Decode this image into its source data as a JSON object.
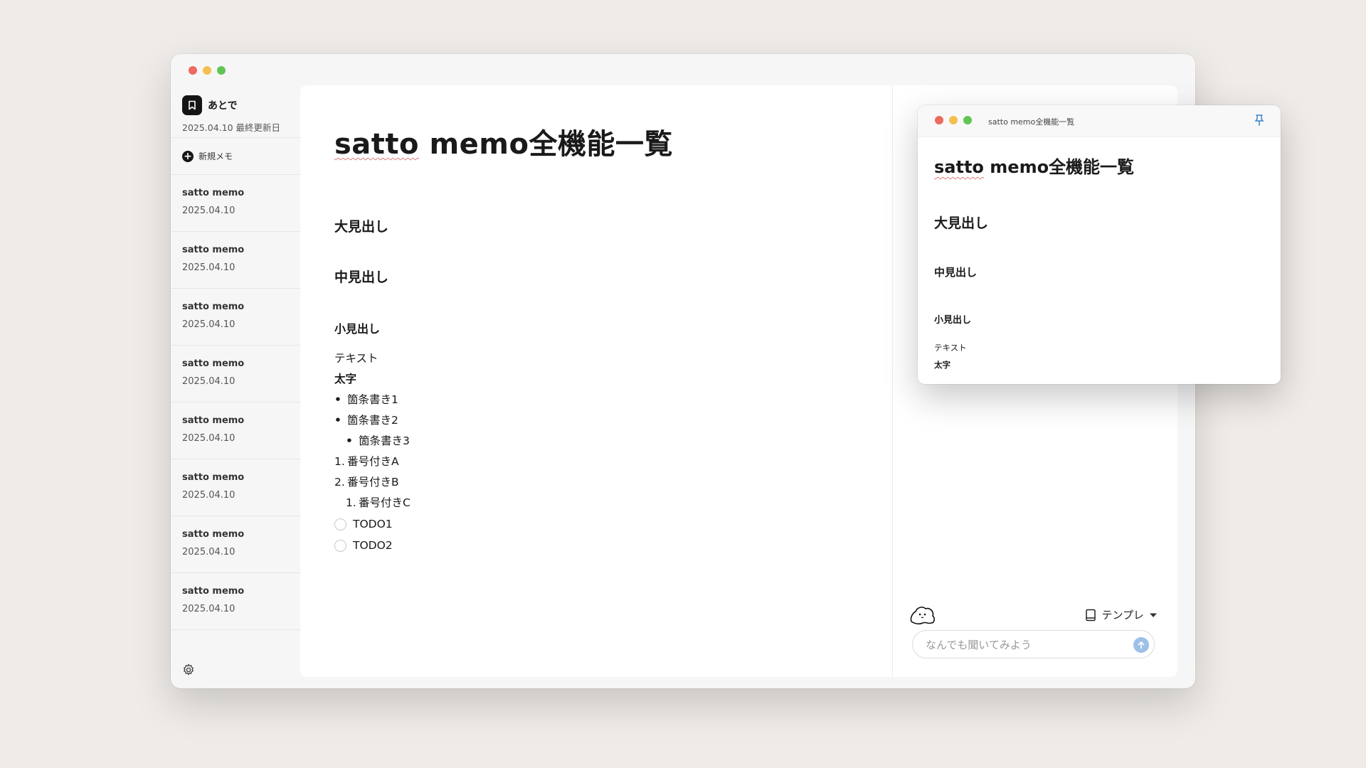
{
  "app": {
    "brand_name": "あとで",
    "last_updated": "2025.04.10 最終更新日",
    "new_memo_label": "新規メモ"
  },
  "memos": [
    {
      "title": "satto memo",
      "date": "2025.04.10"
    },
    {
      "title": "satto memo",
      "date": "2025.04.10"
    },
    {
      "title": "satto memo",
      "date": "2025.04.10"
    },
    {
      "title": "satto memo",
      "date": "2025.04.10"
    },
    {
      "title": "satto memo",
      "date": "2025.04.10"
    },
    {
      "title": "satto memo",
      "date": "2025.04.10"
    },
    {
      "title": "satto memo",
      "date": "2025.04.10"
    },
    {
      "title": "satto memo",
      "date": "2025.04.10"
    }
  ],
  "document": {
    "title_latin": "satto",
    "title_rest": " memo全機能一覧",
    "heading_large": "大見出し",
    "heading_medium": "中見出し",
    "heading_small": "小見出し",
    "text": "テキスト",
    "bold_text": "太字",
    "bullet_marker": "•",
    "bullets": [
      "箇条書き1",
      "箇条書き2",
      "箇条書き3"
    ],
    "numbered": [
      {
        "marker": "1.",
        "text": "番号付きA"
      },
      {
        "marker": "2.",
        "text": "番号付きB"
      },
      {
        "marker": "1.",
        "text": "番号付きC"
      }
    ],
    "todos": [
      "TODO1",
      "TODO2"
    ]
  },
  "assistant": {
    "template_label": "テンプレ",
    "chat_placeholder": "なんでも聞いてみよう",
    "top_dots": "··"
  },
  "float_window": {
    "title": "satto memo全機能一覧"
  },
  "icons": {
    "brand": "bookmark-icon",
    "new": "plus-circle-icon",
    "settings": "gear-icon",
    "mascot": "mascot-icon",
    "template": "book-icon",
    "send": "arrow-up-icon",
    "pin": "pin-icon"
  },
  "colors": {
    "background": "#efebe8",
    "accent_send": "#9dbfe8",
    "pin": "#3b82c4",
    "traffic_red": "#ed6a5e",
    "traffic_yellow": "#f5bf4f",
    "traffic_green": "#61c554"
  }
}
